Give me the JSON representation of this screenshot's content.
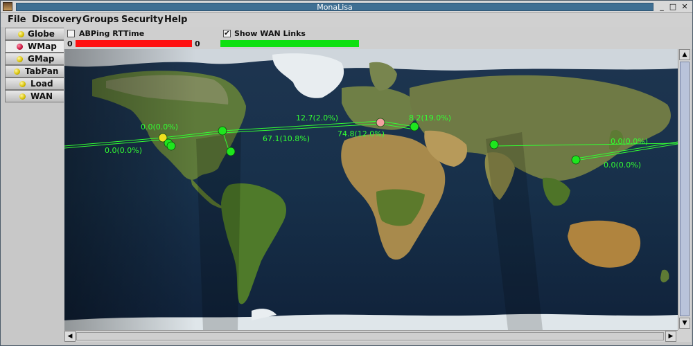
{
  "window": {
    "title": "MonaLisa"
  },
  "menu": [
    "File",
    "Discovery",
    "Groups",
    "Security",
    "Help"
  ],
  "tabs": [
    {
      "label": "Globe",
      "color": "#e6d400"
    },
    {
      "label": "WMap",
      "color": "#c8103c",
      "active": true
    },
    {
      "label": "GMap",
      "color": "#e6d400"
    },
    {
      "label": "TabPan",
      "color": "#e6d400"
    },
    {
      "label": "Load",
      "color": "#e6d400"
    },
    {
      "label": "WAN",
      "color": "#e6d400"
    }
  ],
  "toolbar": {
    "abping_label": "ABPing RTTime",
    "abping_checked": false,
    "abping_min": "0",
    "abping_max": "0",
    "abping_color": "#ff1010",
    "wan_label": "Show WAN Links",
    "wan_checked": true,
    "wan_color": "#10e010",
    "check_glyph": "✔"
  },
  "map": {
    "link_color": "#33ff33",
    "link_labels": [
      "12.7(2.0%)",
      "8.2(19.0%)",
      "0.0(0.0%)",
      "74.8(12.0%)",
      "67.1(10.8%)",
      "0.0(0.0%)",
      "0.0(0.0%)",
      "0.0(0.0%)"
    ],
    "node_colors": {
      "normal": "#1ee61e",
      "warn": "#f0e020",
      "alert": "#f4a0a0"
    }
  },
  "scroll": {
    "up": "▲",
    "down": "▼",
    "left": "◀",
    "right": "▶"
  },
  "window_buttons": {
    "minimize": "_",
    "maximize": "□",
    "close": "✕"
  }
}
